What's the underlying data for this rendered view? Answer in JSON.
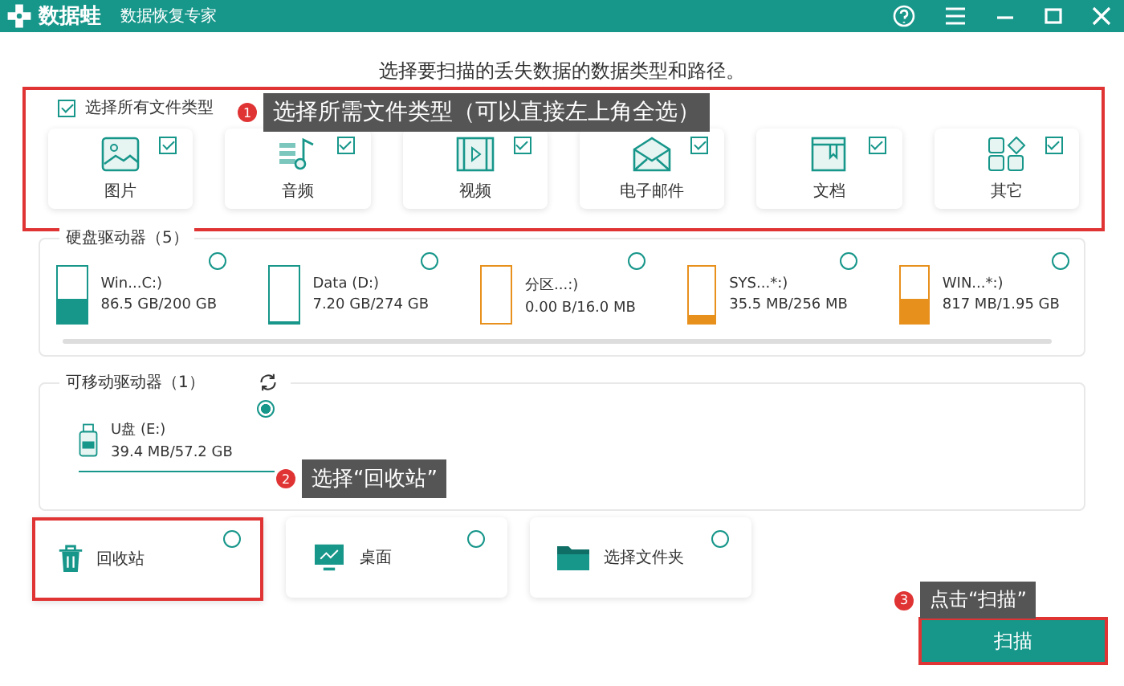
{
  "app": {
    "name": "数据蛙",
    "subtitle": "数据恢复专家"
  },
  "heading": "选择要扫描的丢失数据的数据类型和路径。",
  "file_types": {
    "highlighted": true,
    "select_all": {
      "label": "选择所有文件类型",
      "checked": true
    },
    "items": [
      {
        "kind": "image",
        "label": "图片",
        "checked": true
      },
      {
        "kind": "audio",
        "label": "音频",
        "checked": true
      },
      {
        "kind": "video",
        "label": "视频",
        "checked": true
      },
      {
        "kind": "email",
        "label": "电子邮件",
        "checked": true
      },
      {
        "kind": "document",
        "label": "文档",
        "checked": true
      },
      {
        "kind": "other",
        "label": "其它",
        "checked": true
      }
    ]
  },
  "hard_drives": {
    "label": "硬盘驱动器（5）",
    "items": [
      {
        "name": "Win...C:)",
        "usage": "86.5 GB/200 GB",
        "level": 0.43,
        "color": "#17968a",
        "selected": false
      },
      {
        "name": "Data (D:)",
        "usage": "7.20 GB/274 GB",
        "level": 0.03,
        "color": "#17968a",
        "selected": false
      },
      {
        "name": "分区...:)",
        "usage": "0.00  B/16.0 MB",
        "level": 0,
        "color": "#e8901c",
        "selected": false
      },
      {
        "name": "SYS...*:)",
        "usage": "35.5 MB/256 MB",
        "level": 0.14,
        "color": "#e8901c",
        "selected": false
      },
      {
        "name": "WIN...*:)",
        "usage": "817 MB/1.95 GB",
        "level": 0.42,
        "color": "#e8901c",
        "selected": false
      }
    ]
  },
  "removable": {
    "label": "可移动驱动器（1）",
    "items": [
      {
        "name": "U盘 (E:)",
        "usage": "39.4 MB/57.2 GB",
        "selected": true
      }
    ]
  },
  "locations": [
    {
      "kind": "trash",
      "label": "回收站",
      "selected": false,
      "highlighted": true
    },
    {
      "kind": "desktop",
      "label": "桌面",
      "selected": false,
      "highlighted": false
    },
    {
      "kind": "folder",
      "label": "选择文件夹",
      "selected": false,
      "highlighted": false
    }
  ],
  "scan_button": {
    "label": "扫描",
    "highlighted": true
  },
  "callouts": [
    {
      "number": "1",
      "text": "选择所需文件类型（可以直接左上角全选）"
    },
    {
      "number": "2",
      "text": "选择“回收站”"
    },
    {
      "number": "3",
      "text": "点击“扫描”"
    }
  ]
}
